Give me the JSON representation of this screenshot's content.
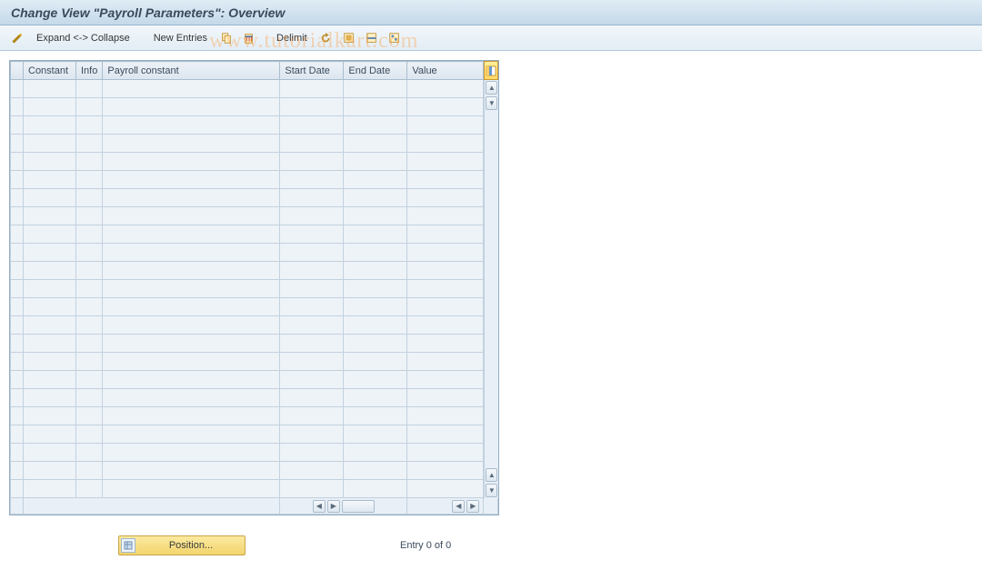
{
  "title": "Change View \"Payroll Parameters\": Overview",
  "toolbar": {
    "expand_collapse": "Expand <-> Collapse",
    "new_entries": "New Entries",
    "delimit": "Delimit"
  },
  "columns": {
    "constant": "Constant",
    "info": "Info",
    "payroll_constant": "Payroll constant",
    "start_date": "Start Date",
    "end_date": "End Date",
    "value": "Value"
  },
  "footer": {
    "position": "Position...",
    "entry": "Entry 0 of 0"
  },
  "watermark": "www.tutorialkart.com",
  "row_count": 23
}
